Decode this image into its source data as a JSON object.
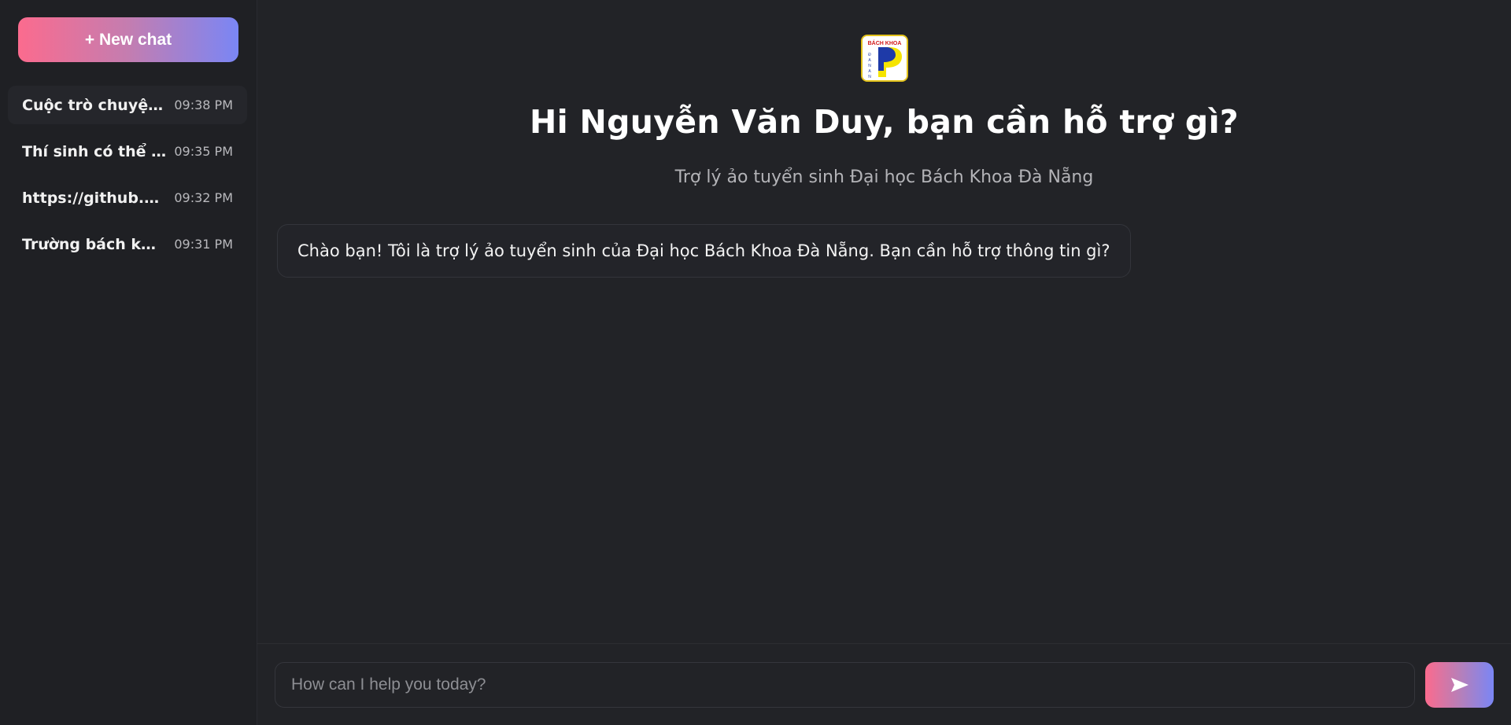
{
  "sidebar": {
    "new_chat_label": "+ New chat",
    "history": [
      {
        "title": "Cuộc trò chuyện m...",
        "time": "09:38 PM",
        "active": true
      },
      {
        "title": "Thí sinh có thể nộ...",
        "time": "09:35 PM",
        "active": false
      },
      {
        "title": "https://github.co...",
        "time": "09:32 PM",
        "active": false
      },
      {
        "title": "Trường bách khoa ...",
        "time": "09:31 PM",
        "active": false
      }
    ]
  },
  "header": {
    "logo_icon": "bach-khoa-logo-icon",
    "logo_text": "BÁCH KHOA",
    "title": "Hi Nguyễn Văn Duy, bạn cần hỗ trợ gì?",
    "subtitle": "Trợ lý ảo tuyển sinh Đại học Bách Khoa Đà Nẵng"
  },
  "messages": [
    {
      "role": "assistant",
      "text": "Chào bạn! Tôi là trợ lý ảo tuyển sinh của Đại học Bách Khoa Đà Nẵng. Bạn cần hỗ trợ thông tin gì?"
    }
  ],
  "composer": {
    "placeholder": "How can I help you today?",
    "value": "",
    "send_icon": "send-icon"
  },
  "colors": {
    "background": "#222327",
    "sidebar": "#1f2024",
    "gradient_start": "#fb6b8e",
    "gradient_end": "#7a86f5"
  }
}
